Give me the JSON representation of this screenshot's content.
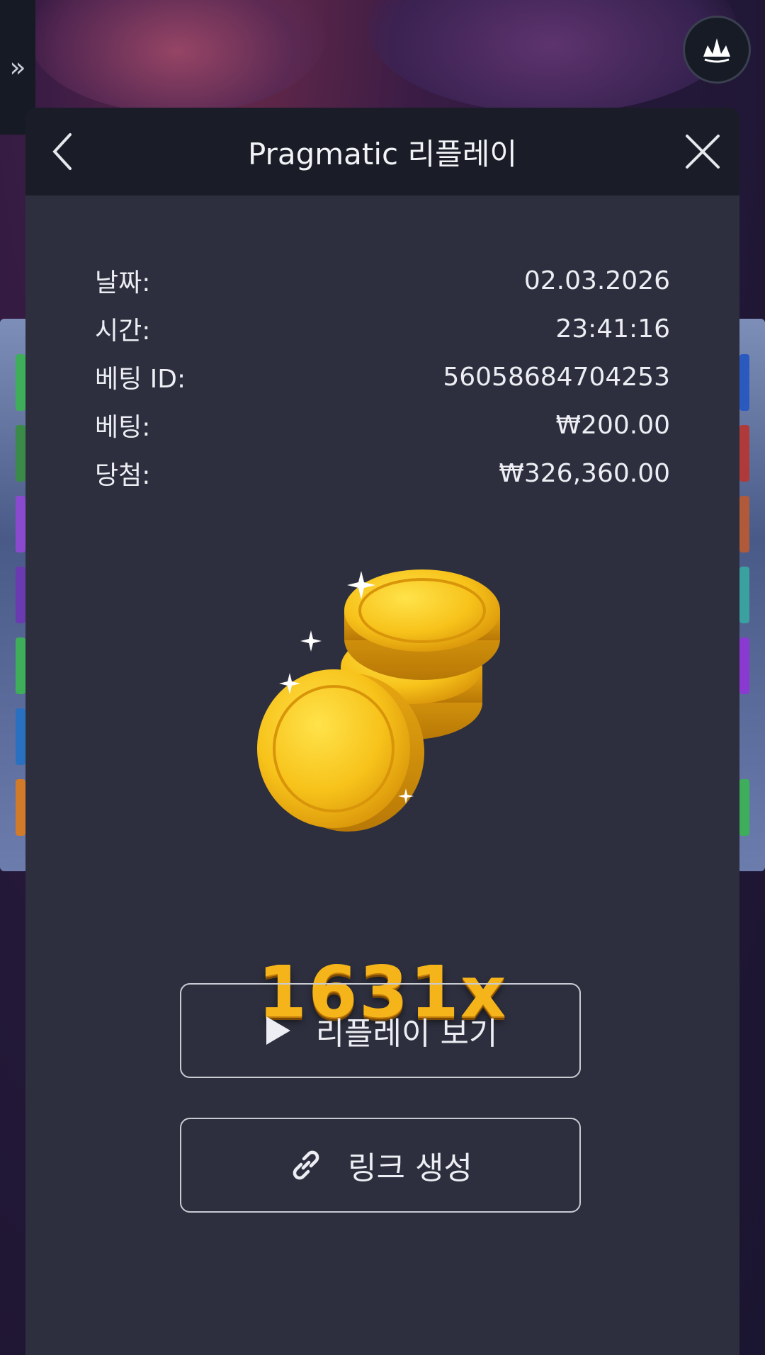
{
  "side_tab": {
    "icon": "double-chevron-right-icon",
    "glyph": "»"
  },
  "header": {
    "title": "Pragmatic 리플레이",
    "back_icon": "chevron-left-icon",
    "close_icon": "close-icon"
  },
  "details": [
    {
      "label": "날짜:",
      "value": "02.03.2026"
    },
    {
      "label": "시간:",
      "value": "23:41:16"
    },
    {
      "label": "베팅 ID:",
      "value": "56058684704253"
    },
    {
      "label": "베팅:",
      "value": "₩200.00"
    },
    {
      "label": "당첨:",
      "value": "₩326,360.00"
    }
  ],
  "win": {
    "multiplier": "1631x",
    "image": "gold-coins-icon"
  },
  "buttons": {
    "replay_label": "리플레이 보기",
    "replay_icon": "play-icon",
    "link_label": "링크 생성",
    "link_icon": "link-icon"
  },
  "colors": {
    "modal_bg": "#2d2f3e",
    "header_bg": "#1a1d27",
    "multiplier": "#f5b51a"
  }
}
